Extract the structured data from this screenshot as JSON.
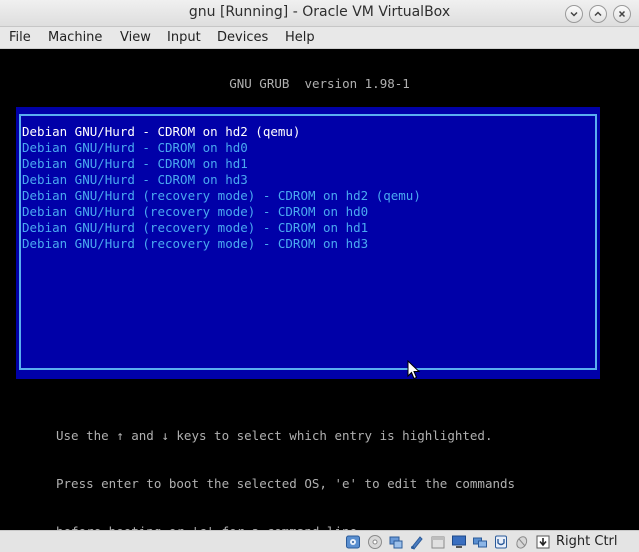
{
  "window": {
    "title": "gnu [Running] - Oracle VM VirtualBox"
  },
  "menubar": {
    "items": [
      "File",
      "Machine",
      "View",
      "Input",
      "Devices",
      "Help"
    ]
  },
  "grub": {
    "header": "GNU GRUB  version 1.98-1",
    "entries": [
      "Debian GNU/Hurd - CDROM on hd2 (qemu)",
      "Debian GNU/Hurd - CDROM on hd0",
      "Debian GNU/Hurd - CDROM on hd1",
      "Debian GNU/Hurd - CDROM on hd3",
      "Debian GNU/Hurd (recovery mode) - CDROM on hd2 (qemu)",
      "Debian GNU/Hurd (recovery mode) - CDROM on hd0",
      "Debian GNU/Hurd (recovery mode) - CDROM on hd1",
      "Debian GNU/Hurd (recovery mode) - CDROM on hd3"
    ],
    "selected_index": 0,
    "help": [
      "Use the ↑ and ↓ keys to select which entry is highlighted.",
      "Press enter to boot the selected OS, 'e' to edit the commands",
      "before booting or 'c' for a command-line."
    ]
  },
  "statusbar": {
    "icons": [
      "hard-disk-icon",
      "optical-drive-icon",
      "usb-icon",
      "shared-folder-icon",
      "clipboard-icon",
      "display-icon",
      "network-icon",
      "capture-icon",
      "mouse-integration-icon",
      "keyboard-capture-icon"
    ],
    "host_key": "Right Ctrl"
  },
  "colors": {
    "grub_background": "#0000a8",
    "grub_border": "#5aaef0",
    "entry_text": "#4aa8f0",
    "selected_text": "#ffffff"
  }
}
